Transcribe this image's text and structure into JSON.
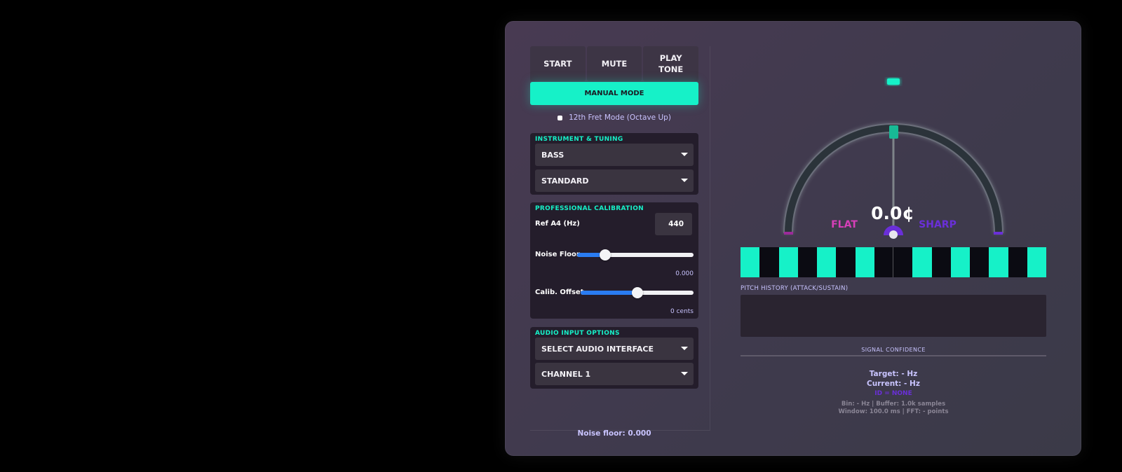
{
  "controls": {
    "start": "START",
    "mute": "MUTE",
    "play_tone": "PLAY TONE",
    "manual_mode": "MANUAL MODE"
  },
  "fret_mode": {
    "label": "12th Fret Mode (Octave Up)",
    "checked": false
  },
  "instrument": {
    "title": "INSTRUMENT & TUNING",
    "instrument_value": "BASS",
    "tuning_value": "STANDARD"
  },
  "calibration": {
    "title": "PROFESSIONAL CALIBRATION",
    "ref_label": "Ref A4 (Hz)",
    "ref_value": "440",
    "noise_label": "Noise Floor",
    "noise_value": "0.000",
    "noise_level": 0.24,
    "offset_label": "Calib. Offset",
    "offset_value": "0 cents",
    "offset_level": 0.5
  },
  "audio": {
    "title": "AUDIO INPUT OPTIONS",
    "interface_value": "SELECT AUDIO INTERFACE",
    "channel_value": "CHANNEL 1"
  },
  "noise_floor_status": "Noise floor: 0.000",
  "meter": {
    "cents": "0.0¢",
    "flat": "FLAT",
    "sharp": "SHARP"
  },
  "history": {
    "label": "PITCH HISTORY (ATTACK/SUSTAIN)"
  },
  "signal": {
    "label": "SIGNAL CONFIDENCE"
  },
  "readout": {
    "target": "Target: - Hz",
    "current": "Current: - Hz",
    "status": "ID = NONE",
    "details_1": "Bin: - Hz | Buffer: 1.0k samples",
    "details_2": "Window: 100.0 ms | FFT: - points"
  },
  "colors": {
    "accent": "#16f1c8",
    "slider": "#2a7cf2",
    "flat": "#d63fb8",
    "sharp": "#6a2fd8",
    "label": "#c9c4ff"
  },
  "strip_pattern": [
    "teal",
    "dark",
    "teal",
    "dark",
    "teal",
    "dark",
    "teal",
    "dark",
    "dark",
    "teal",
    "dark",
    "teal",
    "dark",
    "teal",
    "dark",
    "teal"
  ]
}
